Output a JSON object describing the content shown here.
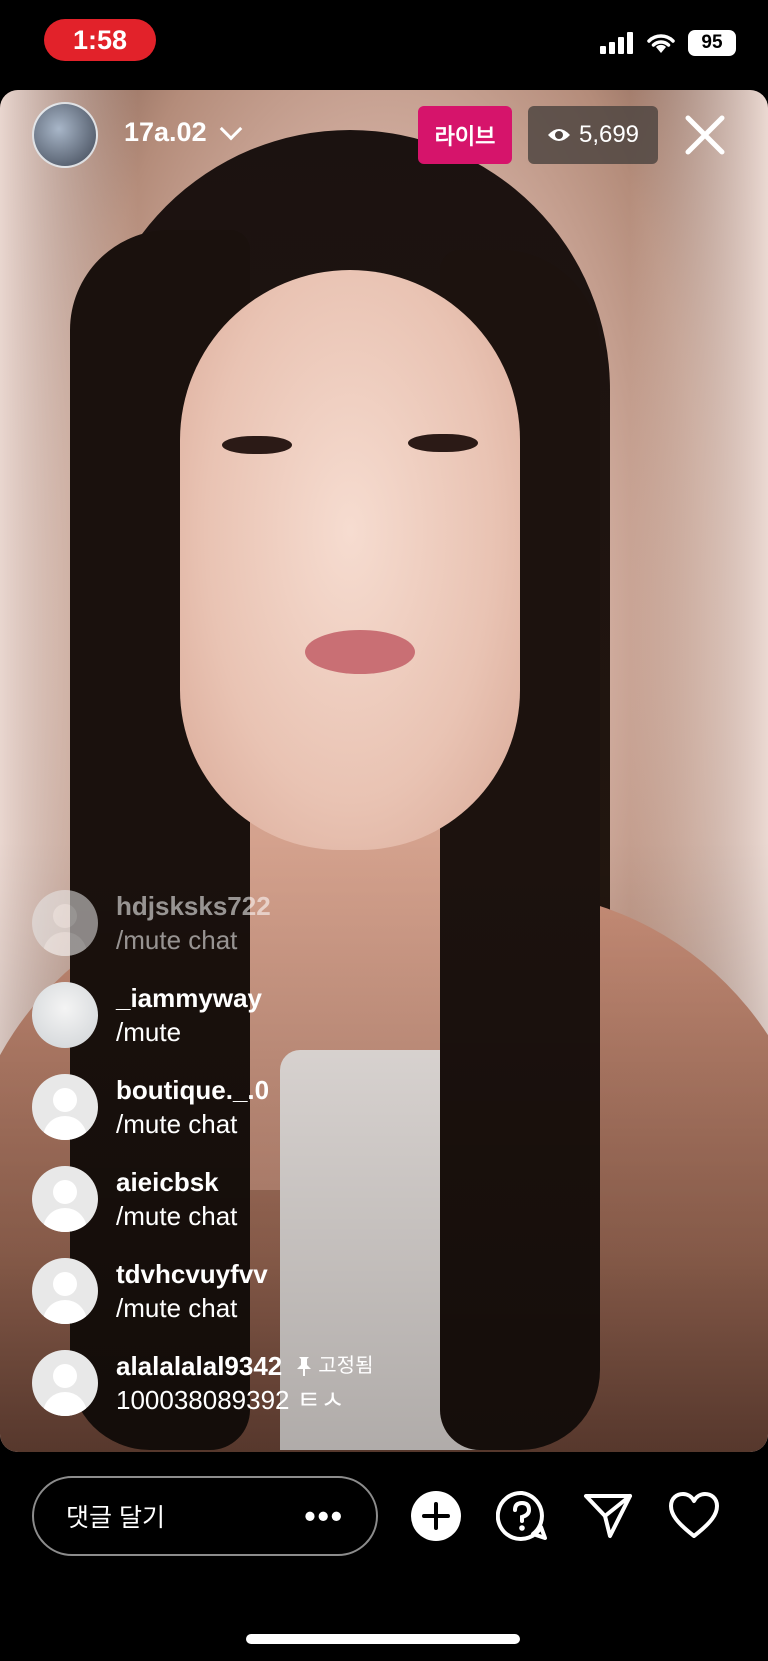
{
  "status_bar": {
    "time": "1:58",
    "battery": "95"
  },
  "header": {
    "username": "17a.02",
    "live_label": "라이브",
    "viewer_count": "5,699"
  },
  "comments": [
    {
      "user": "hdjsksks722",
      "message": "/mute chat"
    },
    {
      "user": "_iammyway",
      "message": "/mute"
    },
    {
      "user": "boutique._.0",
      "message": "/mute chat"
    },
    {
      "user": "aieicbsk",
      "message": "/mute chat"
    },
    {
      "user": "tdvhcvuyfvv",
      "message": "/mute chat"
    },
    {
      "user": "alalalalal9342",
      "message": "100038089392 ㅌㅅ",
      "pinned_label": "고정됨"
    }
  ],
  "bottom_bar": {
    "comment_placeholder": "댓글 달기",
    "more_label": "•••"
  },
  "colors": {
    "live_badge": "#d6146b",
    "time_pill": "#e2222a"
  },
  "icons": [
    "signal-icon",
    "wifi-icon",
    "eye-icon",
    "close-icon",
    "pin-icon",
    "add-icon",
    "question-icon",
    "send-icon",
    "heart-icon"
  ]
}
